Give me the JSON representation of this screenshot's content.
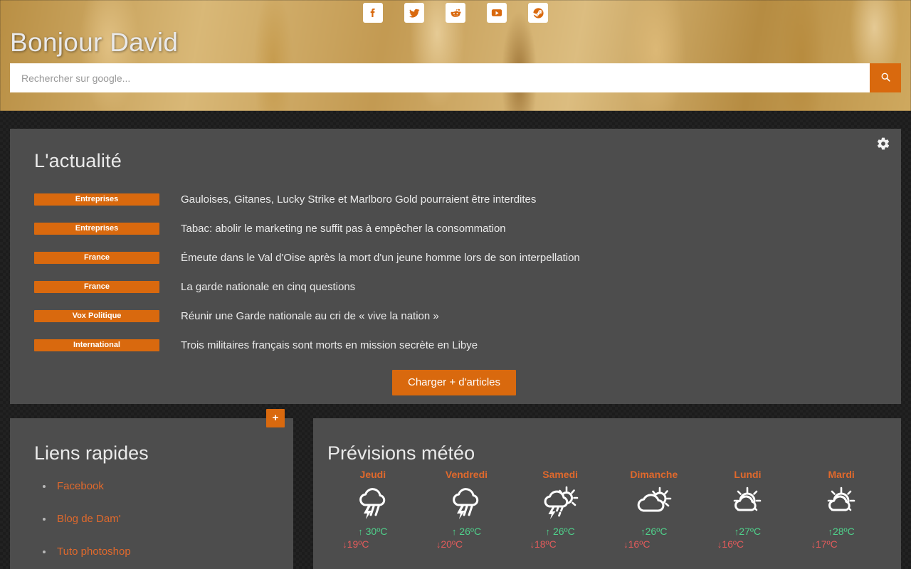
{
  "header": {
    "greeting": "Bonjour David",
    "social": [
      {
        "name": "facebook-icon",
        "label": "Facebook"
      },
      {
        "name": "twitter-icon",
        "label": "Twitter"
      },
      {
        "name": "reddit-icon",
        "label": "Reddit"
      },
      {
        "name": "youtube-icon",
        "label": "YouTube"
      },
      {
        "name": "steam-icon",
        "label": "Steam"
      }
    ],
    "search": {
      "placeholder": "Rechercher sur google...",
      "value": "",
      "button_icon": "search-icon"
    }
  },
  "colors": {
    "accent": "#d9690e",
    "panel": "#4d4d4d",
    "page_bg": "#1c1c1c",
    "link": "#e0692c",
    "temp_high": "#4fd18b",
    "temp_low": "#e05b5b"
  },
  "news": {
    "title": "L'actualité",
    "settings_icon": "gear-icon",
    "items": [
      {
        "category": "Entreprises",
        "headline": "Gauloises, Gitanes, Lucky Strike et Marlboro Gold pourraient être interdites"
      },
      {
        "category": "Entreprises",
        "headline": "Tabac: abolir le marketing ne suffit pas à empêcher la consommation"
      },
      {
        "category": "France",
        "headline": "Émeute dans le Val d'Oise après la mort d'un jeune homme lors de son interpellation"
      },
      {
        "category": "France",
        "headline": "La garde nationale en cinq questions"
      },
      {
        "category": "Vox Politique",
        "headline": "Réunir une Garde nationale au cri de « vive la nation »"
      },
      {
        "category": "International",
        "headline": "Trois militaires français sont morts en mission secrète en Libye"
      }
    ],
    "load_more_label": "Charger + d'articles"
  },
  "quick_links": {
    "title": "Liens rapides",
    "add_label": "+",
    "items": [
      {
        "label": "Facebook"
      },
      {
        "label": "Blog de Dam'"
      },
      {
        "label": "Tuto photoshop"
      }
    ]
  },
  "weather": {
    "title": "Prévisions météo",
    "days": [
      {
        "name": "Jeudi",
        "icon": "thunderstorm-rain-icon",
        "high": "30ºC",
        "low": "19ºC"
      },
      {
        "name": "Vendredi",
        "icon": "thunderstorm-rain-icon",
        "high": "26ºC",
        "low": "20ºC"
      },
      {
        "name": "Samedi",
        "icon": "sun-cloud-thunderstorm-icon",
        "high": "26ºC",
        "low": "18ºC"
      },
      {
        "name": "Dimanche",
        "icon": "sun-cloud-icon",
        "high": "26ºC",
        "low": "16ºC"
      },
      {
        "name": "Lundi",
        "icon": "sun-small-cloud-icon",
        "high": "27ºC",
        "low": "16ºC"
      },
      {
        "name": "Mardi",
        "icon": "sun-small-cloud-icon",
        "high": "28ºC",
        "low": "17ºC"
      }
    ],
    "up_arrow": "↑",
    "down_arrow": "↓"
  }
}
